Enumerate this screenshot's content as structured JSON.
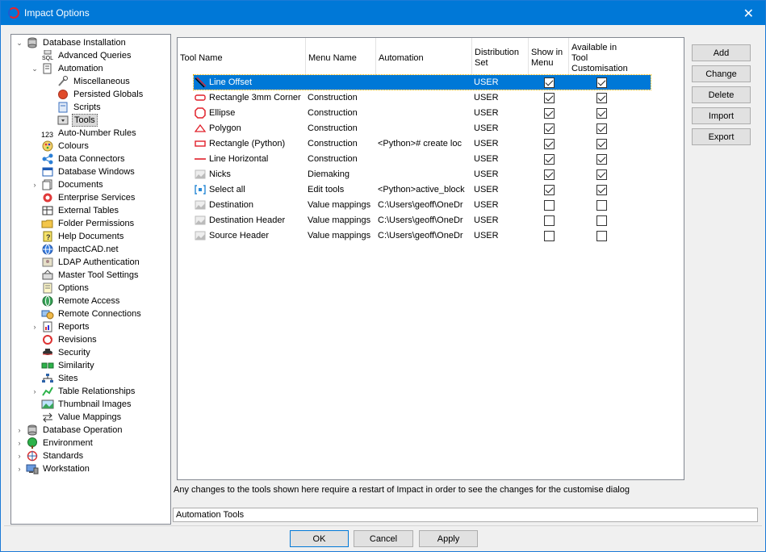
{
  "window": {
    "title": "Impact Options",
    "close_glyph": "✕"
  },
  "tree": {
    "items": [
      {
        "label": "Database Installation",
        "icon": "database-icon",
        "level": 0,
        "expander": "expanded"
      },
      {
        "label": "Advanced Queries",
        "icon": "sql-icon",
        "level": 1,
        "expander": "none"
      },
      {
        "label": "Automation",
        "icon": "document-icon",
        "level": 1,
        "expander": "expanded"
      },
      {
        "label": "Miscellaneous",
        "icon": "tools-icon",
        "level": 2,
        "expander": "none"
      },
      {
        "label": "Persisted Globals",
        "icon": "globe-red-icon",
        "level": 2,
        "expander": "none"
      },
      {
        "label": "Scripts",
        "icon": "script-icon",
        "level": 2,
        "expander": "none"
      },
      {
        "label": "Tools",
        "icon": "toolbar-icon",
        "level": 2,
        "expander": "none",
        "selected": true
      },
      {
        "label": "Auto-Number Rules",
        "icon": "numbers-icon",
        "level": 1,
        "expander": "none"
      },
      {
        "label": "Colours",
        "icon": "palette-icon",
        "level": 1,
        "expander": "none"
      },
      {
        "label": "Data Connectors",
        "icon": "connector-icon",
        "level": 1,
        "expander": "none"
      },
      {
        "label": "Database Windows",
        "icon": "window-icon",
        "level": 1,
        "expander": "none"
      },
      {
        "label": "Documents",
        "icon": "documents-icon",
        "level": 1,
        "expander": "collapsed"
      },
      {
        "label": "Enterprise Services",
        "icon": "enterprise-icon",
        "level": 1,
        "expander": "none"
      },
      {
        "label": "External Tables",
        "icon": "table-icon",
        "level": 1,
        "expander": "none"
      },
      {
        "label": "Folder Permissions",
        "icon": "folder-icon",
        "level": 1,
        "expander": "none"
      },
      {
        "label": "Help Documents",
        "icon": "help-icon",
        "level": 1,
        "expander": "none"
      },
      {
        "label": "ImpactCAD.net",
        "icon": "globe-icon",
        "level": 1,
        "expander": "none"
      },
      {
        "label": "LDAP Authentication",
        "icon": "ldap-icon",
        "level": 1,
        "expander": "none"
      },
      {
        "label": "Master Tool Settings",
        "icon": "master-tools-icon",
        "level": 1,
        "expander": "none"
      },
      {
        "label": "Options",
        "icon": "options-icon",
        "level": 1,
        "expander": "none"
      },
      {
        "label": "Remote Access",
        "icon": "remote-access-icon",
        "level": 1,
        "expander": "none"
      },
      {
        "label": "Remote Connections",
        "icon": "remote-connections-icon",
        "level": 1,
        "expander": "none"
      },
      {
        "label": "Reports",
        "icon": "reports-icon",
        "level": 1,
        "expander": "collapsed"
      },
      {
        "label": "Revisions",
        "icon": "revisions-icon",
        "level": 1,
        "expander": "none"
      },
      {
        "label": "Security",
        "icon": "security-icon",
        "level": 1,
        "expander": "none"
      },
      {
        "label": "Similarity",
        "icon": "similarity-icon",
        "level": 1,
        "expander": "none"
      },
      {
        "label": "Sites",
        "icon": "sites-icon",
        "level": 1,
        "expander": "none"
      },
      {
        "label": "Table Relationships",
        "icon": "relationships-icon",
        "level": 1,
        "expander": "collapsed"
      },
      {
        "label": "Thumbnail Images",
        "icon": "thumbnail-icon",
        "level": 1,
        "expander": "none"
      },
      {
        "label": "Value Mappings",
        "icon": "mapping-icon",
        "level": 1,
        "expander": "none"
      },
      {
        "label": "Database Operation",
        "icon": "database-icon",
        "level": 0,
        "expander": "collapsed"
      },
      {
        "label": "Environment",
        "icon": "environment-icon",
        "level": 0,
        "expander": "collapsed"
      },
      {
        "label": "Standards",
        "icon": "standards-icon",
        "level": 0,
        "expander": "collapsed"
      },
      {
        "label": "Workstation",
        "icon": "workstation-icon",
        "level": 0,
        "expander": "collapsed"
      }
    ]
  },
  "table": {
    "headers": [
      "Tool Name",
      "Menu Name",
      "Automation",
      "Distribution Set",
      "Show in Menu",
      "Available in Tool Customisation"
    ],
    "rows": [
      {
        "icon": "line-offset-icon",
        "name": "Line Offset",
        "menu": "",
        "automation": "",
        "set": "USER",
        "show": true,
        "available": true,
        "selected": true
      },
      {
        "icon": "rectangle-rounded-icon",
        "name": "Rectangle 3mm Corner",
        "menu": "Construction",
        "automation": "",
        "set": "USER",
        "show": true,
        "available": true
      },
      {
        "icon": "ellipse-icon",
        "name": "Ellipse",
        "menu": "Construction",
        "automation": "",
        "set": "USER",
        "show": true,
        "available": true
      },
      {
        "icon": "polygon-icon",
        "name": "Polygon",
        "menu": "Construction",
        "automation": "",
        "set": "USER",
        "show": true,
        "available": true
      },
      {
        "icon": "rectangle-icon",
        "name": "Rectangle (Python)",
        "menu": "Construction",
        "automation": "<Python># create loc",
        "set": "USER",
        "show": true,
        "available": true
      },
      {
        "icon": "line-horizontal-icon",
        "name": "Line Horizontal",
        "menu": "Construction",
        "automation": "",
        "set": "USER",
        "show": true,
        "available": true
      },
      {
        "icon": "image-icon",
        "name": "Nicks",
        "menu": "Diemaking",
        "automation": "",
        "set": "USER",
        "show": true,
        "available": true
      },
      {
        "icon": "select-all-icon",
        "name": "Select all",
        "menu": "Edit tools",
        "automation": "<Python>active_block",
        "set": "USER",
        "show": true,
        "available": true
      },
      {
        "icon": "image-icon",
        "name": "Destination",
        "menu": "Value mappings",
        "automation": "C:\\Users\\geoff\\OneDr",
        "set": "USER",
        "show": false,
        "available": false
      },
      {
        "icon": "image-icon",
        "name": "Destination Header",
        "menu": "Value mappings",
        "automation": "C:\\Users\\geoff\\OneDr",
        "set": "USER",
        "show": false,
        "available": false
      },
      {
        "icon": "image-icon",
        "name": "Source Header",
        "menu": "Value mappings",
        "automation": "C:\\Users\\geoff\\OneDr",
        "set": "USER",
        "show": false,
        "available": false
      }
    ]
  },
  "side_buttons": {
    "add": "Add",
    "change": "Change",
    "delete": "Delete",
    "import": "Import",
    "export": "Export"
  },
  "note": "Any changes to the tools shown here require a restart of Impact in order to see the changes for the customise dialog",
  "status_box": "Automation Tools",
  "footer_buttons": {
    "ok": "OK",
    "cancel": "Cancel",
    "apply": "Apply"
  },
  "colors": {
    "title_bar": "#0078d7",
    "selection": "#0078d7",
    "brand_red": "#e8232a"
  }
}
